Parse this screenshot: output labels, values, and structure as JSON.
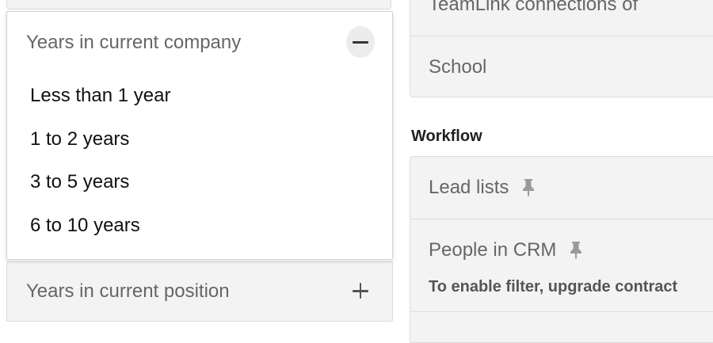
{
  "left": {
    "dropdown": {
      "title": "Years in current company",
      "collapse_icon": "minus-icon",
      "options": [
        "Less than 1 year",
        "1 to 2 years",
        "3 to 5 years",
        "6 to 10 years"
      ]
    },
    "collapsed_filter": {
      "label": "Years in current position",
      "expand_icon": "plus-icon"
    }
  },
  "right": {
    "teamlink_label": "TeamLink connections of",
    "school_label": "School",
    "workflow_heading": "Workflow",
    "lead_lists_label": "Lead lists",
    "crm_label": "People in CRM",
    "crm_note": "To enable filter, upgrade contract",
    "pin_icon": "pin-icon"
  },
  "colors": {
    "card_background": "#f3f3f3",
    "muted_text": "#666666",
    "pin": "#9a9a9a"
  }
}
